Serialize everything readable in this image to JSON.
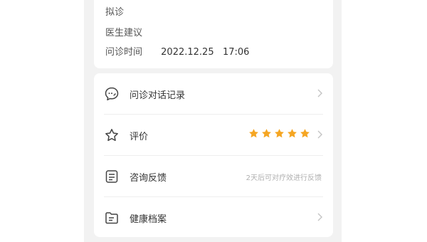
{
  "consult": {
    "diagnosis_label": "拟诊",
    "advice_label": "医生建议",
    "time_label": "问诊时间",
    "time_value": "2022.12.25   17:06"
  },
  "menu": {
    "record_label": "问诊对话记录",
    "review_label": "评价",
    "review_rating": 5,
    "feedback_label": "咨询反馈",
    "feedback_hint": "2天后可对疗效进行反馈",
    "health_label": "健康档案"
  },
  "colors": {
    "star": "#f5a623",
    "background": "#f2f2f2",
    "card": "#ffffff"
  },
  "icons": {
    "record": "chat-bubble-icon",
    "review": "star-outline-icon",
    "feedback": "feedback-form-icon",
    "health": "folder-icon"
  }
}
